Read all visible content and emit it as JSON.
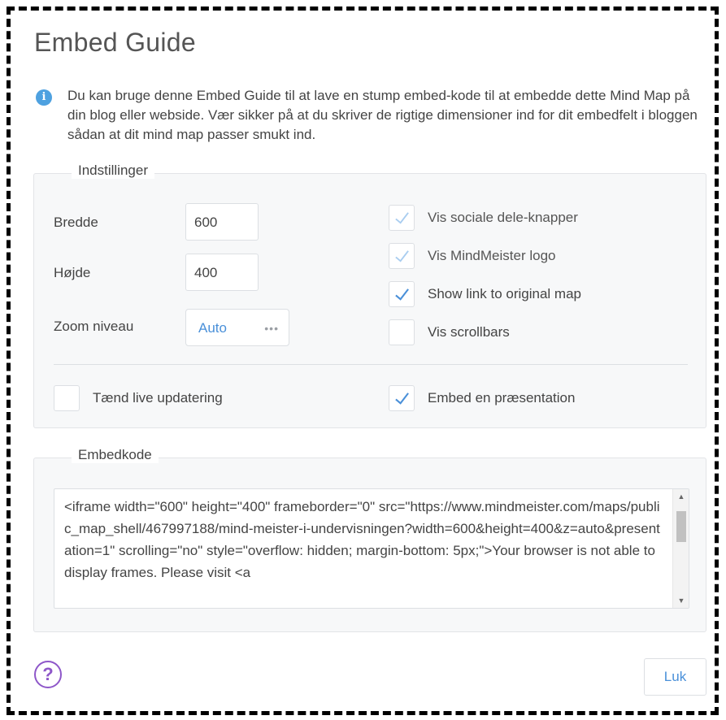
{
  "dialog": {
    "title": "Embed Guide",
    "info_text": "Du kan bruge denne Embed Guide til at lave en stump embed-kode til at embedde dette Mind Map på din blog eller webside. Vær sikker på at du skriver de rigtige dimensioner ind for dit embedfelt i bloggen sådan at dit mind map passer smukt ind.",
    "info_icon": "info-icon",
    "accent_color": "#4a90d9"
  },
  "settings": {
    "legend": "Indstillinger",
    "width_label": "Bredde",
    "width_value": "600",
    "height_label": "Højde",
    "height_value": "400",
    "zoom_label": "Zoom niveau",
    "zoom_value": "Auto",
    "zoom_menu_icon": "•••",
    "options": [
      {
        "label": "Vis sociale dele-knapper",
        "checked": true,
        "disabled": true
      },
      {
        "label": "Vis MindMeister logo",
        "checked": true,
        "disabled": true
      },
      {
        "label": "Show link to original map",
        "checked": true,
        "disabled": false
      },
      {
        "label": "Vis scrollbars",
        "checked": false,
        "disabled": false
      }
    ],
    "live_update_label": "Tænd live updatering",
    "live_update_checked": false,
    "presentation_label": "Embed en præsentation",
    "presentation_checked": true
  },
  "embed": {
    "legend": "Embedkode",
    "code": "<iframe width=\"600\" height=\"400\" frameborder=\"0\" src=\"https://www.mindmeister.com/maps/public_map_shell/467997188/mind-meister-i-undervisningen?width=600&height=400&z=auto&presentation=1\" scrolling=\"no\" style=\"overflow: hidden; margin-bottom: 5px;\">Your browser is not able to display frames. Please visit <a"
  },
  "footer": {
    "help_icon_text": "?",
    "close_label": "Luk"
  }
}
